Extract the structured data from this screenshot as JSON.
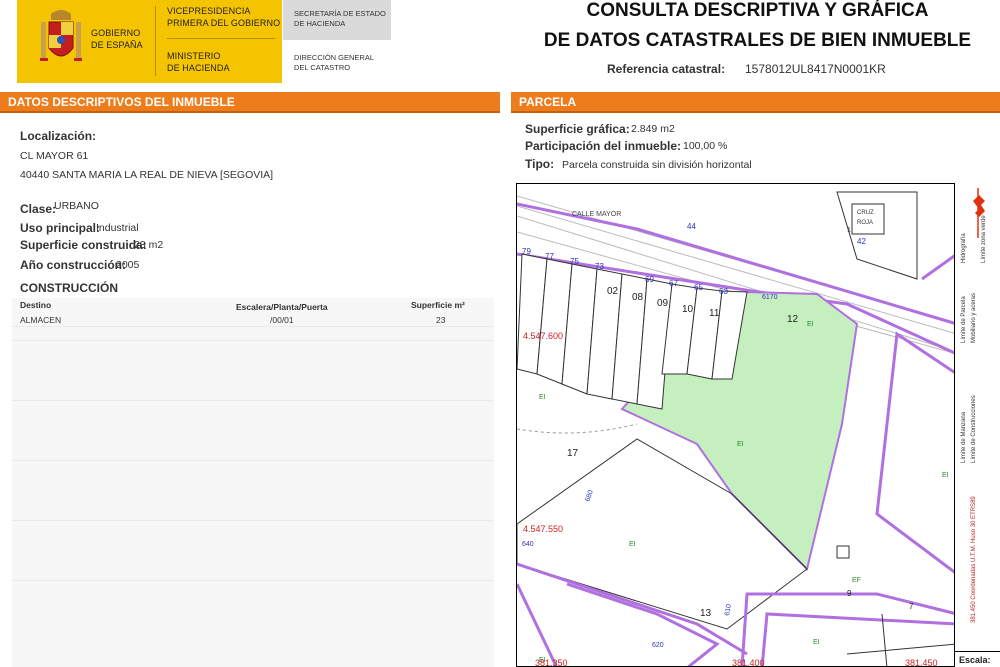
{
  "header": {
    "gov_name": [
      "GOBIERNO",
      "DE ESPAÑA"
    ],
    "vice": [
      "VICEPRESIDENCIA",
      "PRIMERA DEL GOBIERNO"
    ],
    "ministry": [
      "MINISTERIO",
      "DE HACIENDA"
    ],
    "secretaria": [
      "SECRETARÍA DE ESTADO",
      "DE HACIENDA"
    ],
    "direccion": [
      "DIRECCIÓN GENERAL",
      "DEL CATASTRO"
    ],
    "title_line1": "CONSULTA DESCRIPTIVA Y GRÁFICA",
    "title_line2": "DE DATOS CATASTRALES DE BIEN INMUEBLE",
    "ref_label": "Referencia catastral:",
    "ref_value": "1578012UL8417N0001KR",
    "colors": {
      "gov_yellow": "#f5c400",
      "orange": "#ed7d1c"
    }
  },
  "left": {
    "bar_title": "DATOS DESCRIPTIVOS DEL INMUEBLE",
    "localizacion_label": "Localización:",
    "address_line1": "CL MAYOR 61",
    "address_line2": "40440 SANTA MARIA LA REAL DE NIEVA [SEGOVIA]",
    "clase_label": "Clase:",
    "clase_value": "URBANO",
    "uso_label": "Uso principal:",
    "uso_value": "Industrial",
    "superficie_label": "Superficie construida:",
    "superficie_value": "23 m2",
    "anio_label": "Año construcción:",
    "anio_value": "2005",
    "construccion_title": "CONSTRUCCIÓN",
    "table_headers": [
      "Destino",
      "Escalera/Planta/Puerta",
      "Superficie m²"
    ],
    "table_rows": [
      [
        "ALMACEN",
        "/00/01",
        "23"
      ]
    ]
  },
  "right": {
    "bar_title": "PARCELA",
    "superficie_label": "Superficie gráfica:",
    "superficie_value": "2.849 m2",
    "participacion_label": "Participación del inmueble:",
    "participacion_value": "100,00 %",
    "tipo_label": "Tipo:",
    "tipo_value": "Parcela construida sin división horizontal"
  },
  "map": {
    "street": "CALLE MAYOR",
    "cruz_roja": [
      "CRUZ",
      "ROJA"
    ],
    "house_numbers": [
      "79",
      "77",
      "75",
      "73",
      "69",
      "67",
      "65",
      "63",
      "44",
      "42",
      "1"
    ],
    "parcel_numbers": [
      "02",
      "08",
      "09",
      "10",
      "11",
      "12",
      "17",
      "13",
      "9",
      "7"
    ],
    "coord_y1": "4.547.600",
    "coord_y2": "4.547.550",
    "coord_x": [
      "381.350",
      "381.400",
      "381.450"
    ],
    "road_labels": [
      "640",
      "610",
      "620",
      "680",
      "6170"
    ],
    "zone_labels": [
      "EI",
      "EI",
      "EI",
      "EI",
      "EF",
      "EI",
      "EI",
      "EI"
    ],
    "legend": [
      "Límite de Manzana",
      "Límite de Parcela",
      "Límite de Construcciones",
      "Mobiliario y aceras",
      "Límite zona verde",
      "Hidrografía"
    ],
    "crs_note": "381.450 Coordenadas U.T.M. Huso 30 ETRS89",
    "escala_label": "Escala:"
  }
}
